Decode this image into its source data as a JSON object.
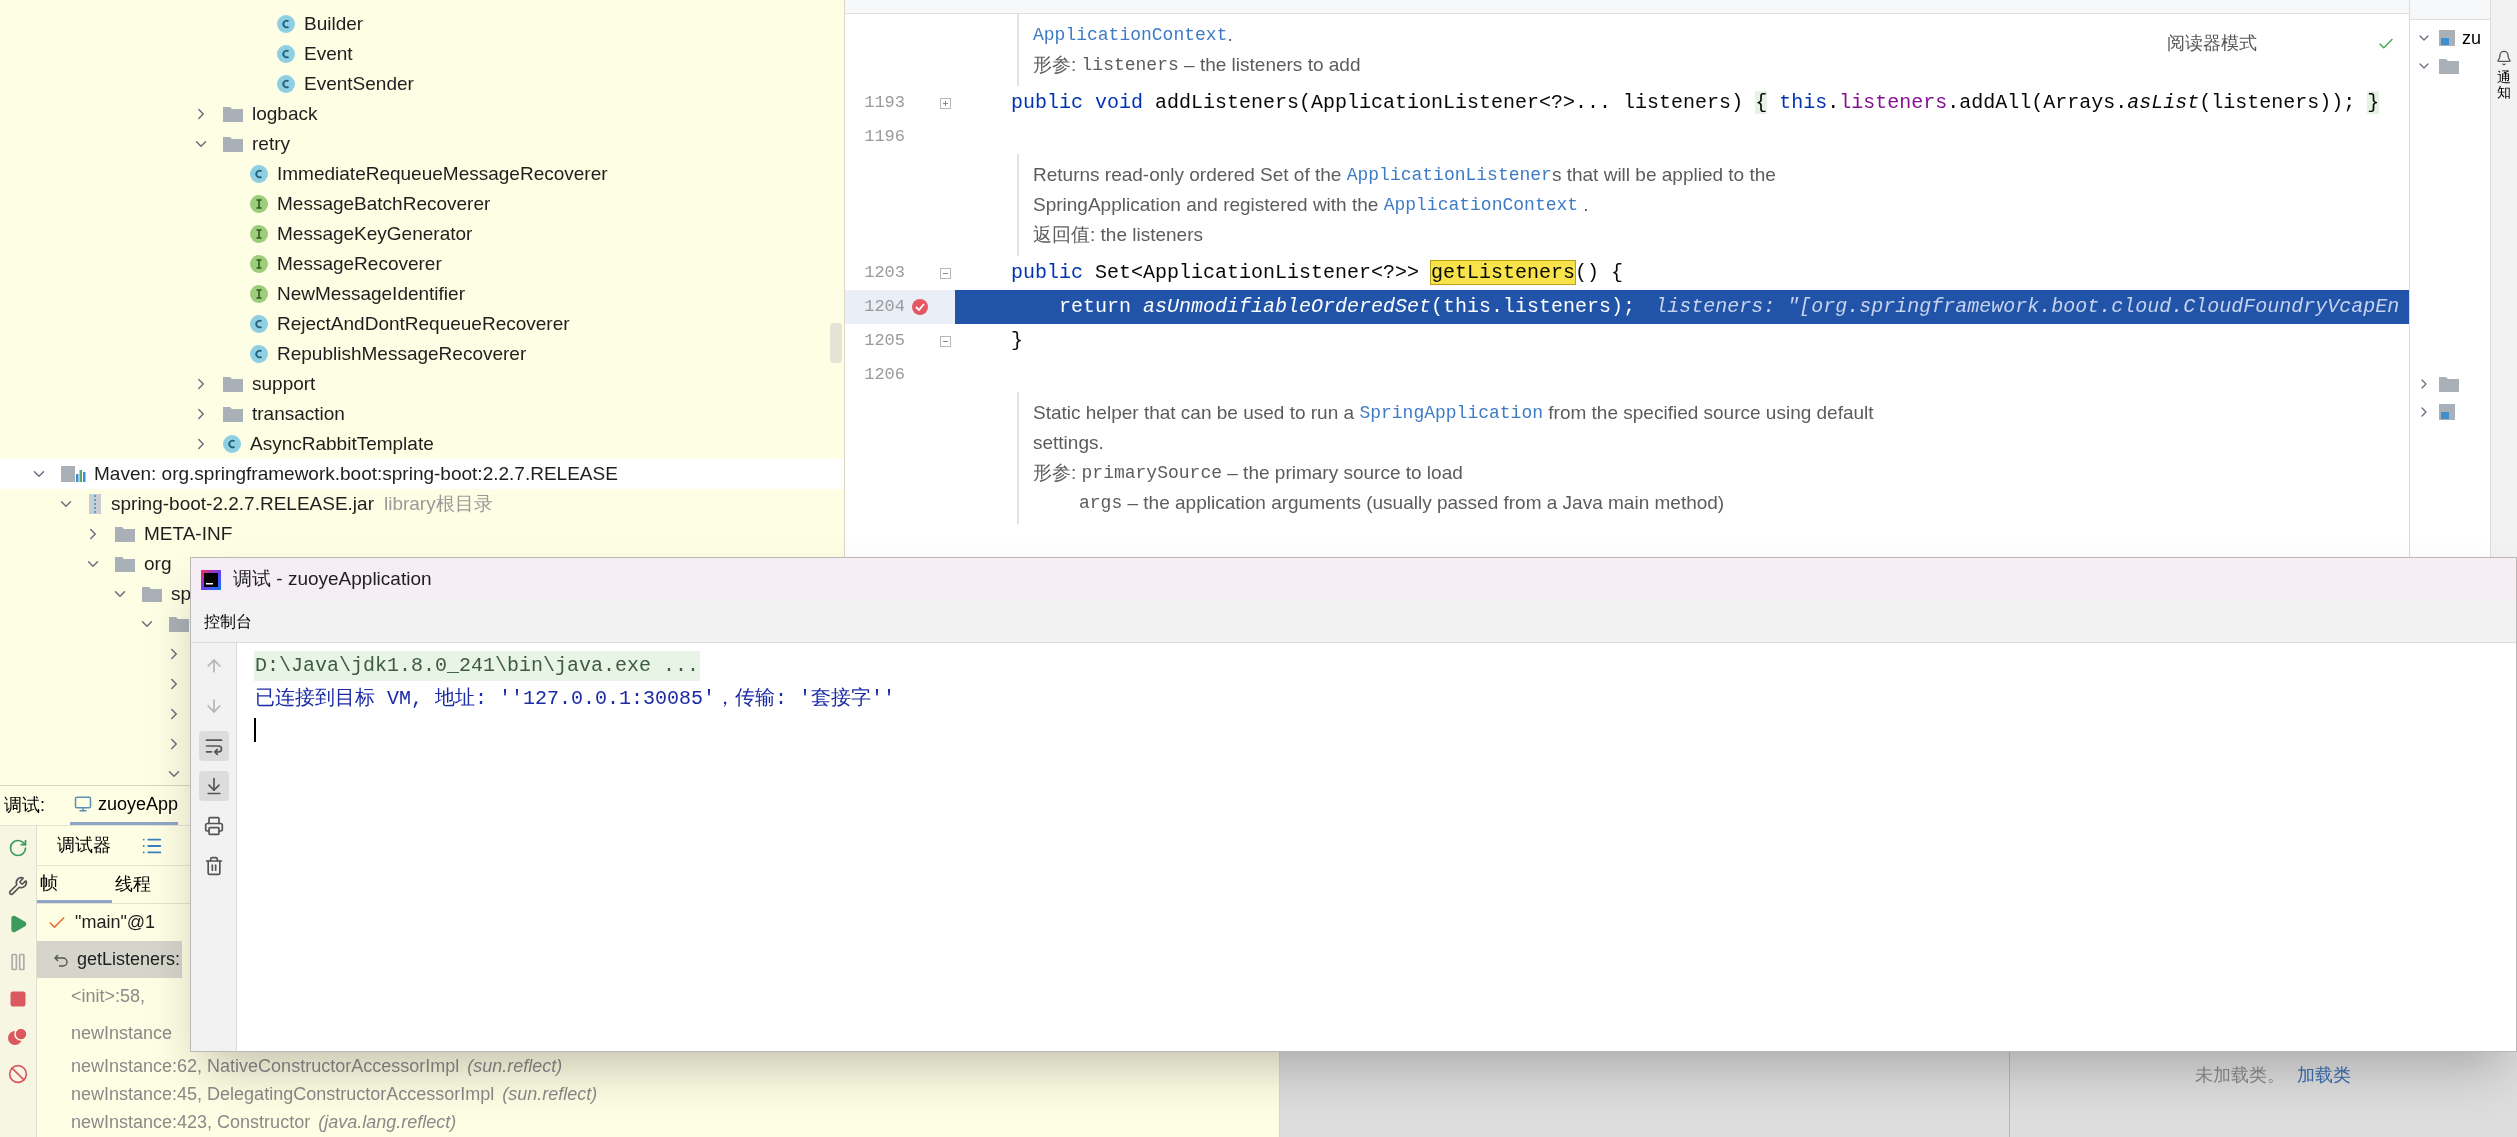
{
  "project_tree": {
    "tail": [
      {
        "kind": "offscreen",
        "children": [
          {
            "kind": "offscreen",
            "children": [
              {
                "kind": "class",
                "label": "Builder"
              },
              {
                "kind": "class",
                "label": "Event"
              },
              {
                "kind": "class",
                "label": "EventSender"
              }
            ]
          }
        ]
      },
      {
        "kind": "folder",
        "label": "logback",
        "expanded": false
      },
      {
        "kind": "folder",
        "label": "retry",
        "expanded": true,
        "children": [
          {
            "kind": "class",
            "label": "ImmediateRequeueMessageRecoverer"
          },
          {
            "kind": "interface",
            "label": "MessageBatchRecoverer"
          },
          {
            "kind": "interface",
            "label": "MessageKeyGenerator"
          },
          {
            "kind": "interface",
            "label": "MessageRecoverer"
          },
          {
            "kind": "interface",
            "label": "NewMessageIdentifier"
          },
          {
            "kind": "class",
            "label": "RejectAndDontRequeueRecoverer"
          },
          {
            "kind": "class",
            "label": "RepublishMessageRecoverer"
          }
        ]
      },
      {
        "kind": "folder",
        "label": "support",
        "expanded": false
      },
      {
        "kind": "folder",
        "label": "transaction",
        "expanded": false
      },
      {
        "kind": "class",
        "label": "AsyncRabbitTemplate",
        "expanded": false
      }
    ],
    "roots": [
      {
        "kind": "library",
        "label": "Maven: org.springframework.boot:spring-boot:2.2.7.RELEASE",
        "expanded": true,
        "children": [
          {
            "kind": "jar",
            "label": "spring-boot-2.2.7.RELEASE.jar",
            "note": "library根目录",
            "expanded": true,
            "children": [
              {
                "kind": "folder",
                "label": "META-INF",
                "expanded": false
              },
              {
                "kind": "folder",
                "label": "org",
                "expanded": true,
                "children": [
                  {
                    "kind": "folder",
                    "label": "sp",
                    "expanded": true,
                    "children": [
                      {
                        "kind": "folder",
                        "expanded": true,
                        "children": [
                          {
                            "expanded": false
                          },
                          {
                            "expanded": false
                          },
                          {
                            "expanded": false
                          },
                          {
                            "expanded": false
                          },
                          {
                            "expanded": true
                          }
                        ]
                      }
                    ]
                  }
                ]
              }
            ]
          }
        ]
      }
    ]
  },
  "editor": {
    "reader_mode": "阅读器模式",
    "blocks": [
      {
        "kind": "doc",
        "lines": [
          {
            "indent": false,
            "segments": [
              {
                "kind": "link",
                "text": "ApplicationContext"
              },
              {
                "kind": "text",
                "text": "."
              }
            ]
          },
          {
            "indent": false,
            "segments": [
              {
                "kind": "label",
                "text": "形参: "
              },
              {
                "kind": "mono",
                "text": "listeners"
              },
              {
                "kind": "text",
                "text": " – the listeners to add"
              }
            ]
          }
        ]
      },
      {
        "kind": "code",
        "number": "1193",
        "folded": true,
        "breakpoint": false,
        "selected": false,
        "tokens": [
          {
            "kind": "keyword",
            "text": "public void "
          },
          {
            "kind": "plain",
            "text": "addListeners(ApplicationListener<?>... listeners) "
          },
          {
            "kind": "fold",
            "text": "{"
          },
          {
            "kind": "keyword",
            "text": " this"
          },
          {
            "kind": "plain",
            "text": "."
          },
          {
            "kind": "field",
            "text": "listeners"
          },
          {
            "kind": "plain",
            "text": ".addAll(Arrays."
          },
          {
            "kind": "italic",
            "text": "asList"
          },
          {
            "kind": "plain",
            "text": "(listeners)); "
          },
          {
            "kind": "fold",
            "text": "}"
          }
        ]
      },
      {
        "kind": "code",
        "number": "1196",
        "breakpoint": false,
        "selected": false
      },
      {
        "kind": "doc",
        "lines": [
          {
            "indent": false,
            "segments": [
              {
                "kind": "text",
                "text": "Returns read-only ordered Set of the "
              },
              {
                "kind": "link",
                "text": "ApplicationListener"
              },
              {
                "kind": "text",
                "text": "s that will be applied to the"
              }
            ]
          },
          {
            "indent": false,
            "segments": [
              {
                "kind": "text",
                "text": "SpringApplication and registered with the "
              },
              {
                "kind": "link",
                "text": "ApplicationContext"
              },
              {
                "kind": "text",
                "text": " ."
              }
            ]
          },
          {
            "indent": false,
            "segments": [
              {
                "kind": "label",
                "text": "返回值: "
              },
              {
                "kind": "text",
                "text": "the listeners"
              }
            ]
          }
        ]
      },
      {
        "kind": "code",
        "number": "1203",
        "folded": false,
        "breakpoint": false,
        "selected": false,
        "tokens": [
          {
            "kind": "keyword",
            "text": "public "
          },
          {
            "kind": "plain",
            "text": "Set<ApplicationListener<?>> "
          },
          {
            "kind": "match",
            "text": "getListeners"
          },
          {
            "kind": "plain",
            "text": "() {"
          }
        ]
      },
      {
        "kind": "code",
        "number": "1204",
        "breakpoint": true,
        "selected": true,
        "tokens": [
          {
            "kind": "plain",
            "text": "    return "
          },
          {
            "kind": "italic",
            "text": "asUnmodifiableOrderedSet"
          },
          {
            "kind": "plain",
            "text": "(this.listeners);"
          },
          {
            "kind": "hint",
            "text": "listeners: \"[org.springframework.boot.cloud.CloudFoundryVcapEn"
          }
        ]
      },
      {
        "kind": "code",
        "number": "1205",
        "folded": false,
        "breakpoint": false,
        "selected": false,
        "tokens": [
          {
            "kind": "plain",
            "text": "}"
          }
        ]
      },
      {
        "kind": "code",
        "number": "1206",
        "breakpoint": false,
        "selected": false
      },
      {
        "kind": "doc",
        "lines": [
          {
            "indent": false,
            "segments": [
              {
                "kind": "text",
                "text": "Static helper that can be used to run a "
              },
              {
                "kind": "link",
                "text": "SpringApplication"
              },
              {
                "kind": "text",
                "text": " from the specified source using default"
              }
            ]
          },
          {
            "indent": false,
            "segments": [
              {
                "kind": "text",
                "text": "settings."
              }
            ]
          },
          {
            "indent": false,
            "segments": [
              {
                "kind": "label",
                "text": "形参: "
              },
              {
                "kind": "mono",
                "text": "primarySource"
              },
              {
                "kind": "text",
                "text": " – the primary source to load"
              }
            ]
          },
          {
            "indent": true,
            "segments": [
              {
                "kind": "mono",
                "text": "args"
              },
              {
                "kind": "text",
                "text": " – the application arguments (usually passed from a Java main method)"
              }
            ]
          }
        ]
      }
    ]
  },
  "tool_panel": {
    "rows": [
      {
        "kind": "module",
        "label": "zu",
        "expanded": true
      },
      {
        "kind": "folder",
        "expanded": true
      }
    ],
    "lower_rows": [
      {
        "kind": "folder",
        "expanded": false
      },
      {
        "kind": "module",
        "expanded": false
      }
    ],
    "notifications": "通知"
  },
  "debug_panel": {
    "label": "调试:",
    "tabs": [
      {
        "label": "zuoyeApp",
        "selected": true
      }
    ],
    "toolbar_tab": "调试器",
    "view_tabs": [
      {
        "label": "帧",
        "selected": true
      },
      {
        "label": "线程",
        "selected": false
      }
    ],
    "frames": [
      {
        "kind": "thread",
        "text": "\"main\"@1",
        "selected": false
      },
      {
        "kind": "frame",
        "text": "getListeners:",
        "selected": true
      },
      {
        "kind": "frame",
        "text": "<init>:58,",
        "selected": false
      },
      {
        "kind": "frame",
        "text": "newInstance",
        "selected": false
      },
      {
        "kind": "frame",
        "text": "newInstance:62, NativeConstructorAccessorImpl",
        "package": "(sun.reflect)",
        "selected": false
      },
      {
        "kind": "frame",
        "text": "newInstance:45, DelegatingConstructorAccessorImpl",
        "package": "(sun.reflect)",
        "selected": false
      },
      {
        "kind": "frame",
        "text": "newInstance:423, Constructor",
        "package": "(java.lang.reflect)",
        "selected": false
      }
    ],
    "classes_hint": "未加载类。",
    "load_link": "加载类"
  },
  "console_window": {
    "title": "调试 - zuoyeApplication",
    "tab": "控制台",
    "tools": [
      {
        "kind": "up",
        "disabled": true
      },
      {
        "kind": "down",
        "disabled": true
      },
      {
        "kind": "wrap",
        "on": true
      },
      {
        "kind": "scroll_end",
        "on": true
      },
      {
        "kind": "print"
      },
      {
        "kind": "clear"
      }
    ],
    "lines": [
      {
        "kind": "command",
        "text": "D:\\Java\\jdk1.8.0_241\\bin\\java.exe ..."
      },
      {
        "kind": "info",
        "text": "已连接到目标 VM, 地址: ''127.0.0.1:30085'，传输: '套接字''"
      }
    ]
  }
}
